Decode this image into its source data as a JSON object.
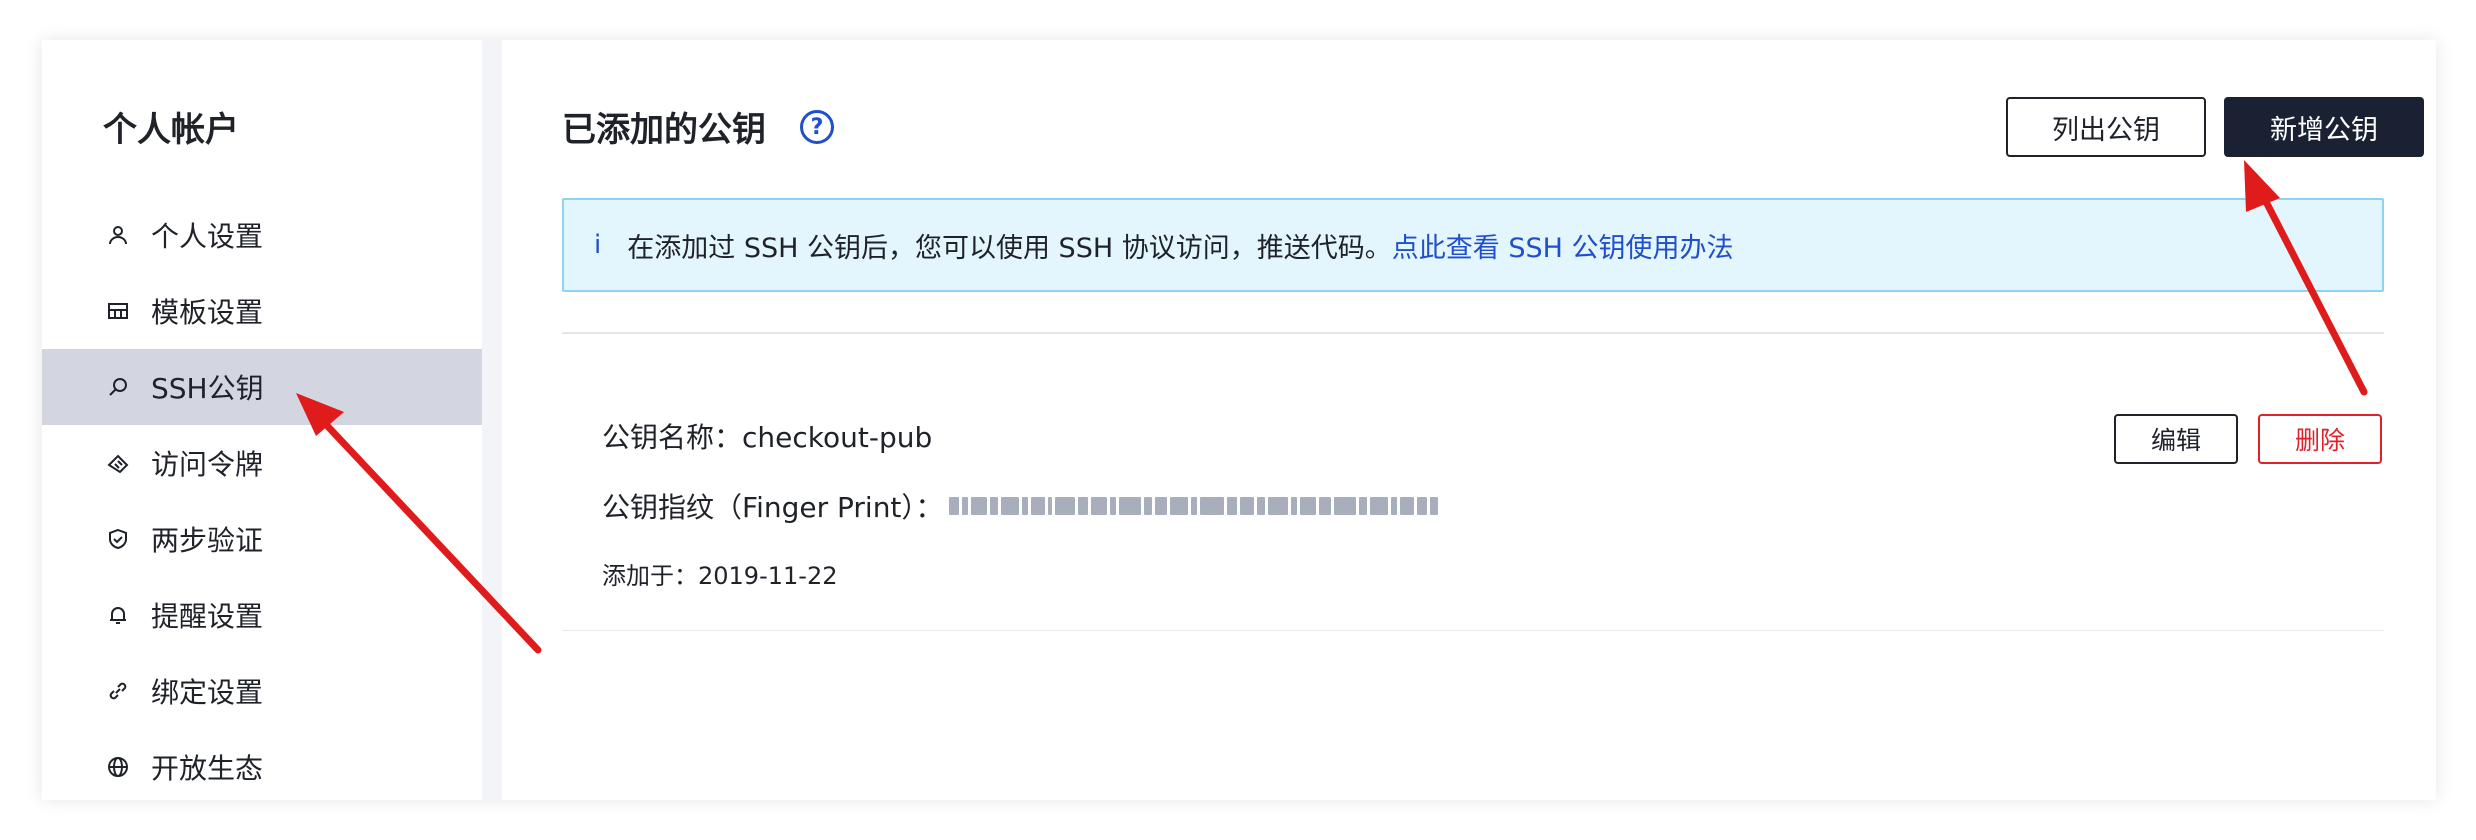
{
  "sidebar": {
    "title": "个人帐户",
    "items": [
      {
        "label": "个人设置",
        "icon": "user-icon",
        "active": false
      },
      {
        "label": "模板设置",
        "icon": "template-icon",
        "active": false
      },
      {
        "label": "SSH公钥",
        "icon": "key-icon",
        "active": true
      },
      {
        "label": "访问令牌",
        "icon": "token-icon",
        "active": false
      },
      {
        "label": "两步验证",
        "icon": "shield-icon",
        "active": false
      },
      {
        "label": "提醒设置",
        "icon": "bell-icon",
        "active": false
      },
      {
        "label": "绑定设置",
        "icon": "link-icon",
        "active": false
      },
      {
        "label": "开放生态",
        "icon": "globe-icon",
        "active": false
      }
    ]
  },
  "main": {
    "title": "已添加的公钥",
    "help_icon": "?",
    "list_button": "列出公钥",
    "add_button": "新增公钥",
    "notice": {
      "icon": "i",
      "text": "在添加过 SSH 公钥后，您可以使用 SSH 协议访问，推送代码。",
      "link": "点此查看 SSH 公钥使用办法"
    },
    "key": {
      "name_label": "公钥名称：",
      "name_value": "checkout-pub",
      "fingerprint_label": "公钥指纹（Finger Print）：",
      "added_label": "添加于：",
      "added_value": "2019-11-22",
      "edit_button": "编辑",
      "delete_button": "删除"
    }
  },
  "colors": {
    "accent": "#1f4fcc",
    "primary_button": "#1a2133",
    "danger": "#e0202a",
    "notice_bg": "#e3f5fd",
    "active_nav": "#d3d6e0",
    "annotation_arrow": "#e01b1b"
  }
}
